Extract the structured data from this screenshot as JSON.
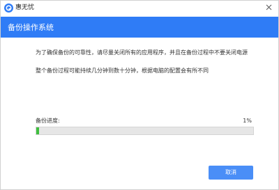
{
  "window": {
    "app_title": "惠无忧",
    "app_icon": "brand-logo-icon",
    "close_icon": "close-icon"
  },
  "header": {
    "title": "备份操作系统",
    "background": "#2f7cf6"
  },
  "message": {
    "line1": "为了确保备份的可靠性，请尽量关闭所有的应用程序，并且在备份过程中不要关闭电源",
    "line2": "整个备份过程可能持续几分钟到数十分钟，根据电脑的配置会有所不同"
  },
  "progress": {
    "label": "备份进度:",
    "percent_text": "1%",
    "value": 0.01,
    "fill_color": "#3fbf3f"
  },
  "actions": {
    "cancel_label": "取消",
    "accent": "#4a8ef7"
  }
}
